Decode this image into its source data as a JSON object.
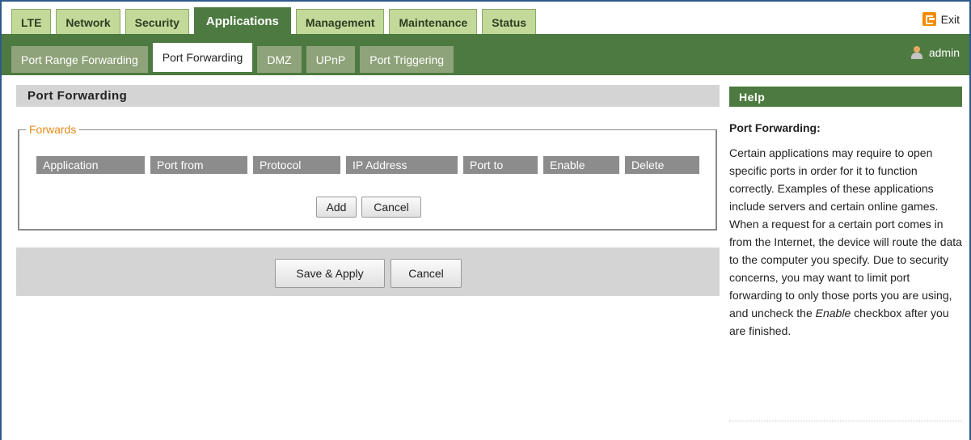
{
  "main_tabs": [
    {
      "label": "LTE"
    },
    {
      "label": "Network"
    },
    {
      "label": "Security"
    },
    {
      "label": "Applications"
    },
    {
      "label": "Management"
    },
    {
      "label": "Maintenance"
    },
    {
      "label": "Status"
    }
  ],
  "active_main_tab": "Applications",
  "exit_label": "Exit",
  "sub_tabs": [
    {
      "label": "Port Range Forwarding"
    },
    {
      "label": "Port Forwarding"
    },
    {
      "label": "DMZ"
    },
    {
      "label": "UPnP"
    },
    {
      "label": "Port Triggering"
    }
  ],
  "active_sub_tab": "Port Forwarding",
  "user_label": "admin",
  "section_title": "Port Forwarding",
  "forwards": {
    "legend": "Forwards",
    "columns": [
      "Application",
      "Port from",
      "Protocol",
      "IP Address",
      "Port to",
      "Enable",
      "Delete"
    ],
    "add_label": "Add",
    "cancel_label": "Cancel"
  },
  "actions": {
    "save_label": "Save & Apply",
    "cancel_label": "Cancel"
  },
  "help": {
    "header": "Help",
    "title": "Port Forwarding:",
    "body_before_em": "Certain applications may require to open specific ports in order for it to function correctly. Examples of these applications include servers and certain online games. When a request for a certain port comes in from the Internet, the device will route the data to the computer you specify. Due to security concerns, you may want to limit port forwarding to only those ports you are using, and uncheck the ",
    "body_em": "Enable",
    "body_after_em": " checkbox after you are finished."
  },
  "colors": {
    "accent_green": "#4d7a40",
    "tab_green": "#c3d99a",
    "legend_orange": "#e88a1a",
    "frame_blue": "#2d5a8a"
  }
}
